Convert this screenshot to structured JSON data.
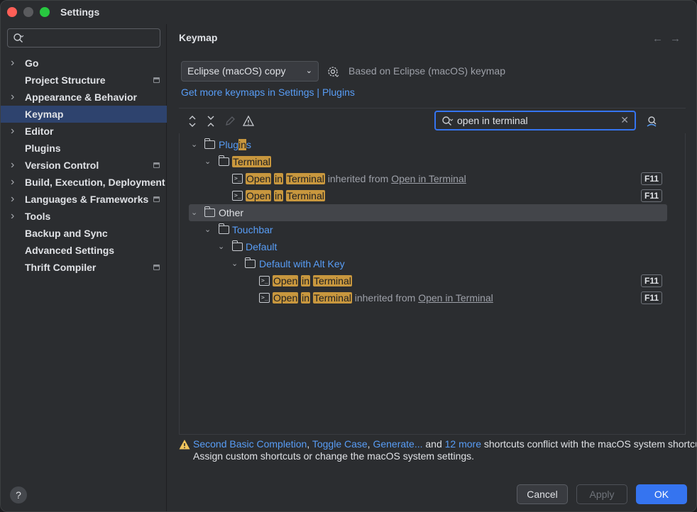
{
  "window": {
    "title": "Settings"
  },
  "sidebar": {
    "search_placeholder": "",
    "items": [
      {
        "label": "Go",
        "expandable": true,
        "project": false
      },
      {
        "label": "Project Structure",
        "expandable": false,
        "project": true
      },
      {
        "label": "Appearance & Behavior",
        "expandable": true,
        "project": false
      },
      {
        "label": "Keymap",
        "expandable": false,
        "project": false,
        "selected": true
      },
      {
        "label": "Editor",
        "expandable": true,
        "project": false
      },
      {
        "label": "Plugins",
        "expandable": false,
        "project": false
      },
      {
        "label": "Version Control",
        "expandable": true,
        "project": true
      },
      {
        "label": "Build, Execution, Deployment",
        "expandable": true,
        "project": false
      },
      {
        "label": "Languages & Frameworks",
        "expandable": true,
        "project": true
      },
      {
        "label": "Tools",
        "expandable": true,
        "project": false
      },
      {
        "label": "Backup and Sync",
        "expandable": false,
        "project": false
      },
      {
        "label": "Advanced Settings",
        "expandable": false,
        "project": false
      },
      {
        "label": "Thrift Compiler",
        "expandable": false,
        "project": true
      }
    ]
  },
  "content": {
    "title": "Keymap",
    "keymap_select": "Eclipse (macOS) copy",
    "based_on": "Based on Eclipse (macOS) keymap",
    "more_link": "Get more keymaps in Settings | Plugins",
    "search_value": "open in terminal"
  },
  "tree": {
    "plugins_label_pre": "Plug",
    "plugins_label_hl": "in",
    "plugins_label_post": "s",
    "terminal_folder": "Terminal",
    "open": "Open",
    "in": "in",
    "terminal": "Terminal",
    "inherited_from": "inherited from",
    "inherited_target": "Open in Terminal",
    "other": "Other",
    "touchbar": "Touchbar",
    "default": "Default",
    "default_alt": "Default with Alt Key",
    "shortcut": "F11"
  },
  "conflict": {
    "link1": "Second Basic Completion",
    "sep1": ", ",
    "link2": "Toggle Case",
    "sep2": ", ",
    "link3": "Generate...",
    "and": " and ",
    "link4": "12 more",
    "rest": " shortcuts conflict with the macOS system shortcut",
    "line2": "Assign custom shortcuts or change the macOS system settings."
  },
  "footer": {
    "help": "?",
    "cancel": "Cancel",
    "apply": "Apply",
    "ok": "OK"
  }
}
